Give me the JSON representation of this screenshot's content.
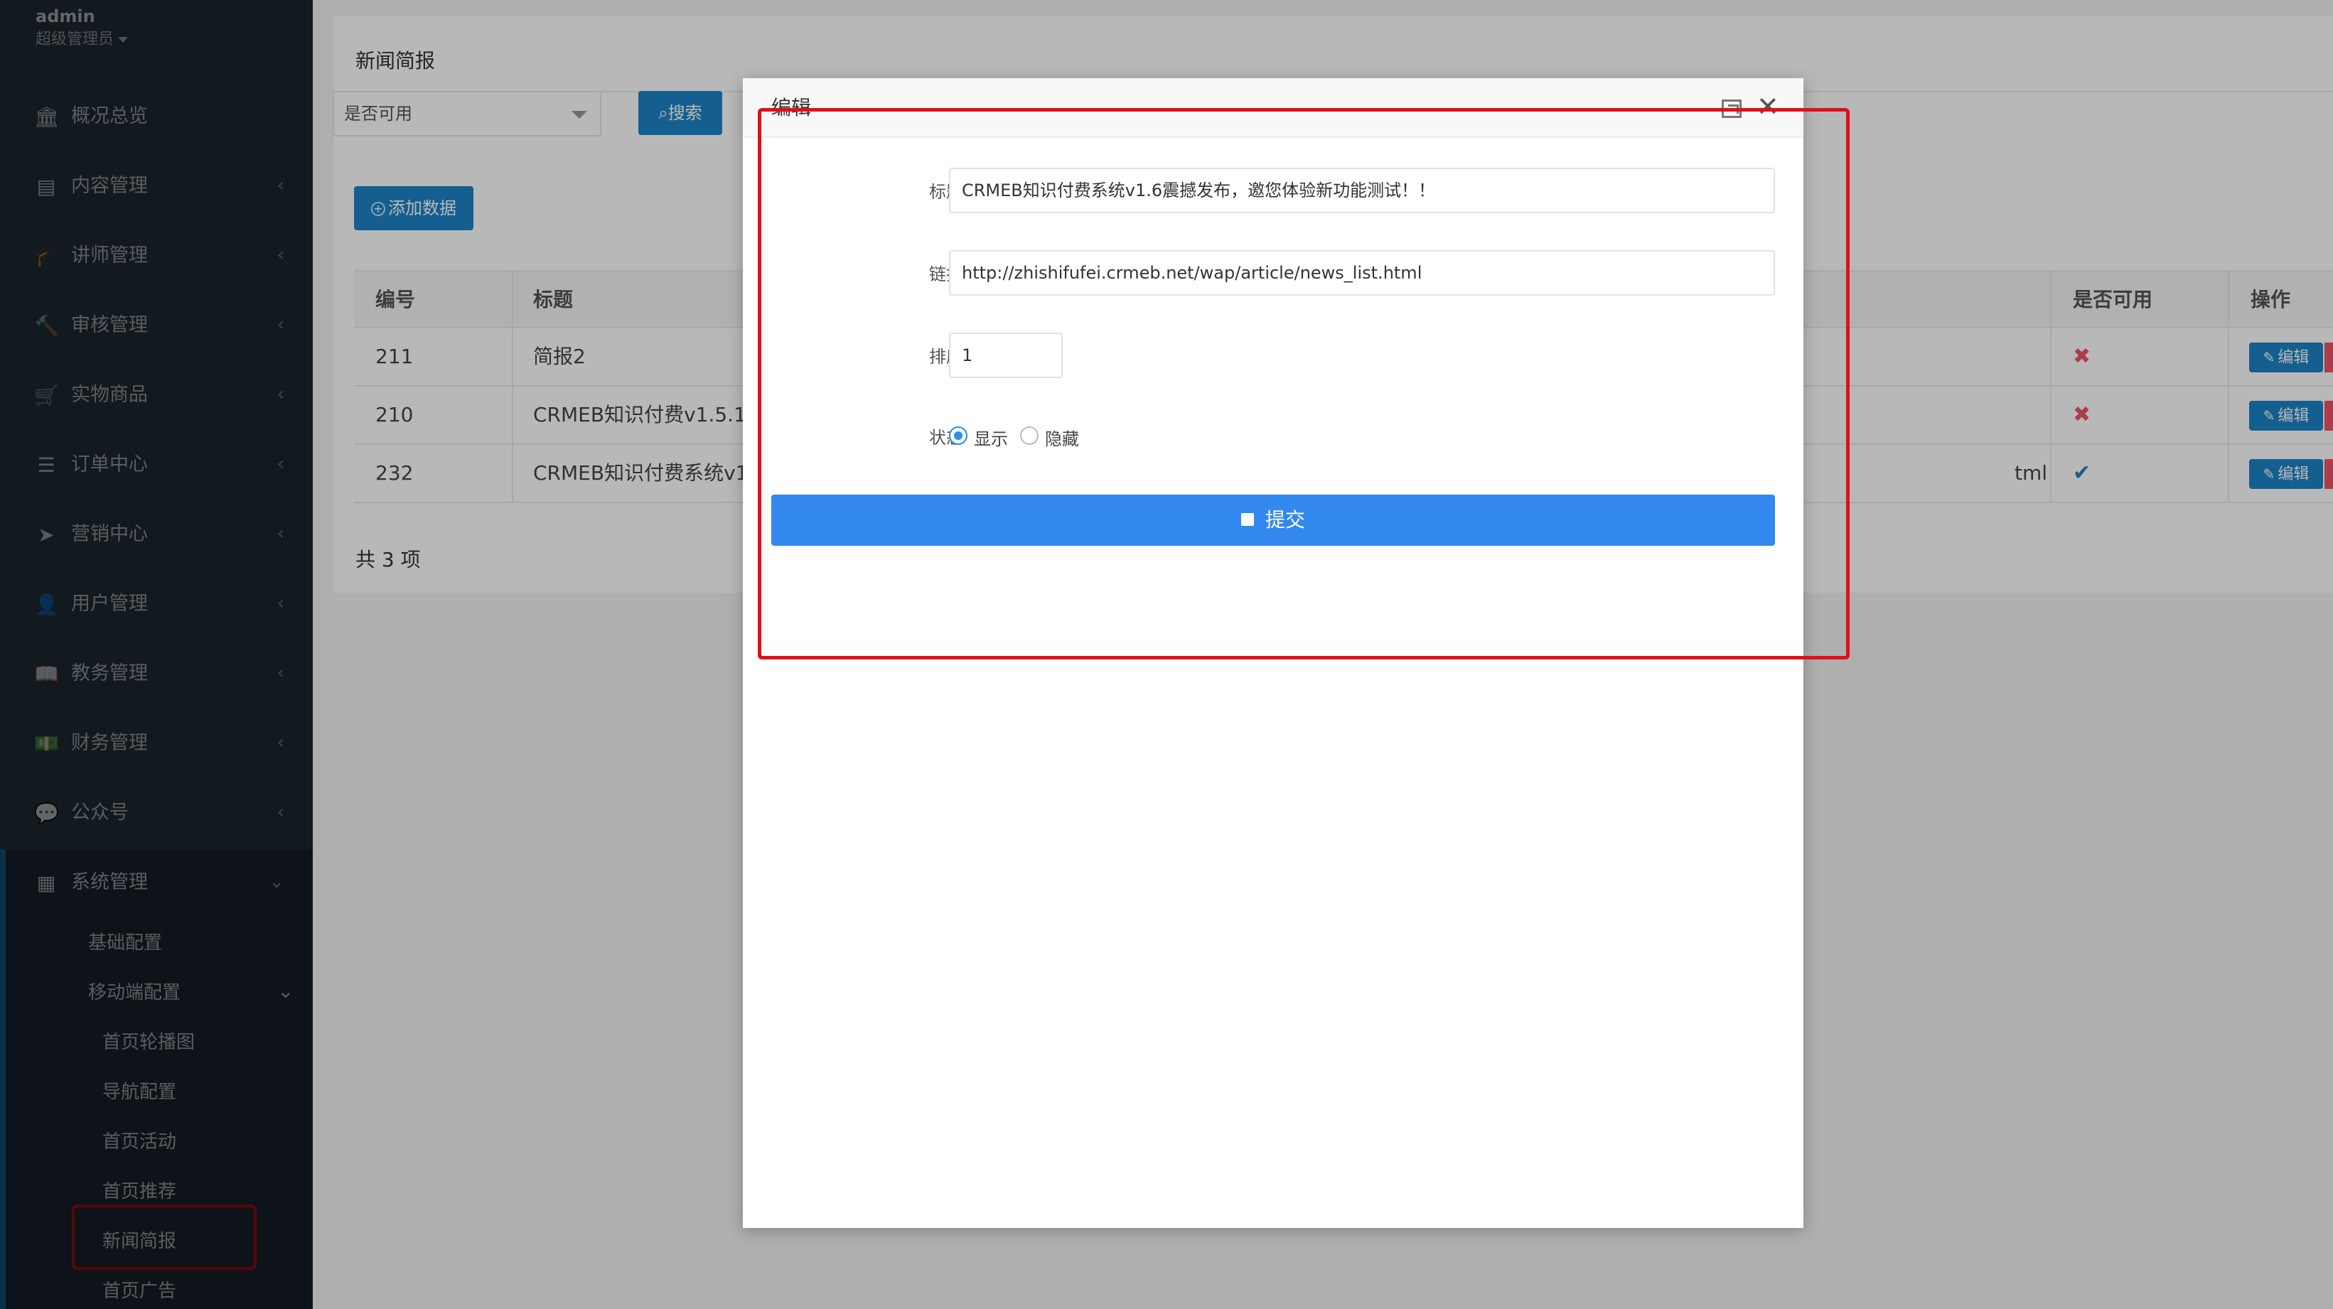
{
  "user": {
    "name": "admin",
    "role": "超级管理员"
  },
  "nav": [
    {
      "icon": "bank-icon",
      "glyph": "🏛",
      "label": "概况总览",
      "arrow": ""
    },
    {
      "icon": "newspaper-icon",
      "glyph": "▤",
      "label": "内容管理",
      "arrow": "‹"
    },
    {
      "icon": "graduation-cap-icon",
      "glyph": "🎓",
      "label": "讲师管理",
      "arrow": "‹"
    },
    {
      "icon": "gavel-icon",
      "glyph": "🔨",
      "label": "审核管理",
      "arrow": "‹"
    },
    {
      "icon": "cart-icon",
      "glyph": "🛒",
      "label": "实物商品",
      "arrow": "‹"
    },
    {
      "icon": "list-icon",
      "glyph": "☰",
      "label": "订单中心",
      "arrow": "‹"
    },
    {
      "icon": "paper-plane-icon",
      "glyph": "➤",
      "label": "营销中心",
      "arrow": "‹"
    },
    {
      "icon": "user-icon",
      "glyph": "👤",
      "label": "用户管理",
      "arrow": "‹"
    },
    {
      "icon": "book-icon",
      "glyph": "📖",
      "label": "教务管理",
      "arrow": "‹"
    },
    {
      "icon": "money-icon",
      "glyph": "💵",
      "label": "财务管理",
      "arrow": "‹"
    },
    {
      "icon": "wechat-icon",
      "glyph": "💬",
      "label": "公众号",
      "arrow": "‹"
    }
  ],
  "system": {
    "label": "系统管理",
    "glyph": "▦",
    "arrow": "⌄",
    "sub": [
      {
        "label": "基础配置"
      },
      {
        "label": "移动端配置",
        "arrow": "⌄"
      }
    ],
    "mobile_sub": [
      "首页轮播图",
      "导航配置",
      "首页活动",
      "首页推荐",
      "新闻简报",
      "首页广告"
    ]
  },
  "page": {
    "title": "新闻简报",
    "filter_placeholder": "是否可用",
    "search_label": "搜索",
    "add_label": "添加数据",
    "total_label": "共 3 项"
  },
  "table": {
    "headers": {
      "id": "编号",
      "title": "标题",
      "enabled": "是否可用",
      "action": "操作"
    },
    "rows": [
      {
        "id": "211",
        "title": "简报2",
        "link_tail": "",
        "enabled_mark": "✖",
        "edit": "编辑"
      },
      {
        "id": "210",
        "title": "CRMEB知识付费v1.5.1",
        "link_tail": "",
        "enabled_mark": "✖",
        "edit": "编辑"
      },
      {
        "id": "232",
        "title": "CRMEB知识付费系统v1",
        "link_tail": "tml",
        "enabled_mark": "✔",
        "edit": "编辑"
      }
    ]
  },
  "modal": {
    "title": "编辑",
    "fields": {
      "title_label": "标题",
      "title_value": "CRMEB知识付费系统v1.6震撼发布，邀您体验新功能测试！！",
      "link_label": "链接",
      "link_value": "http://zhishifufei.crmeb.net/wap/article/news_list.html",
      "sort_label": "排序",
      "sort_value": "1",
      "status_label": "状态",
      "status_show": "显示",
      "status_hide": "隐藏"
    },
    "submit_label": "提交"
  },
  "colors": {
    "sidebar": "#2f4050",
    "primary": "#1c84c6",
    "submit": "#3388f0",
    "highlight": "#e0101a",
    "danger": "#ed5565"
  }
}
